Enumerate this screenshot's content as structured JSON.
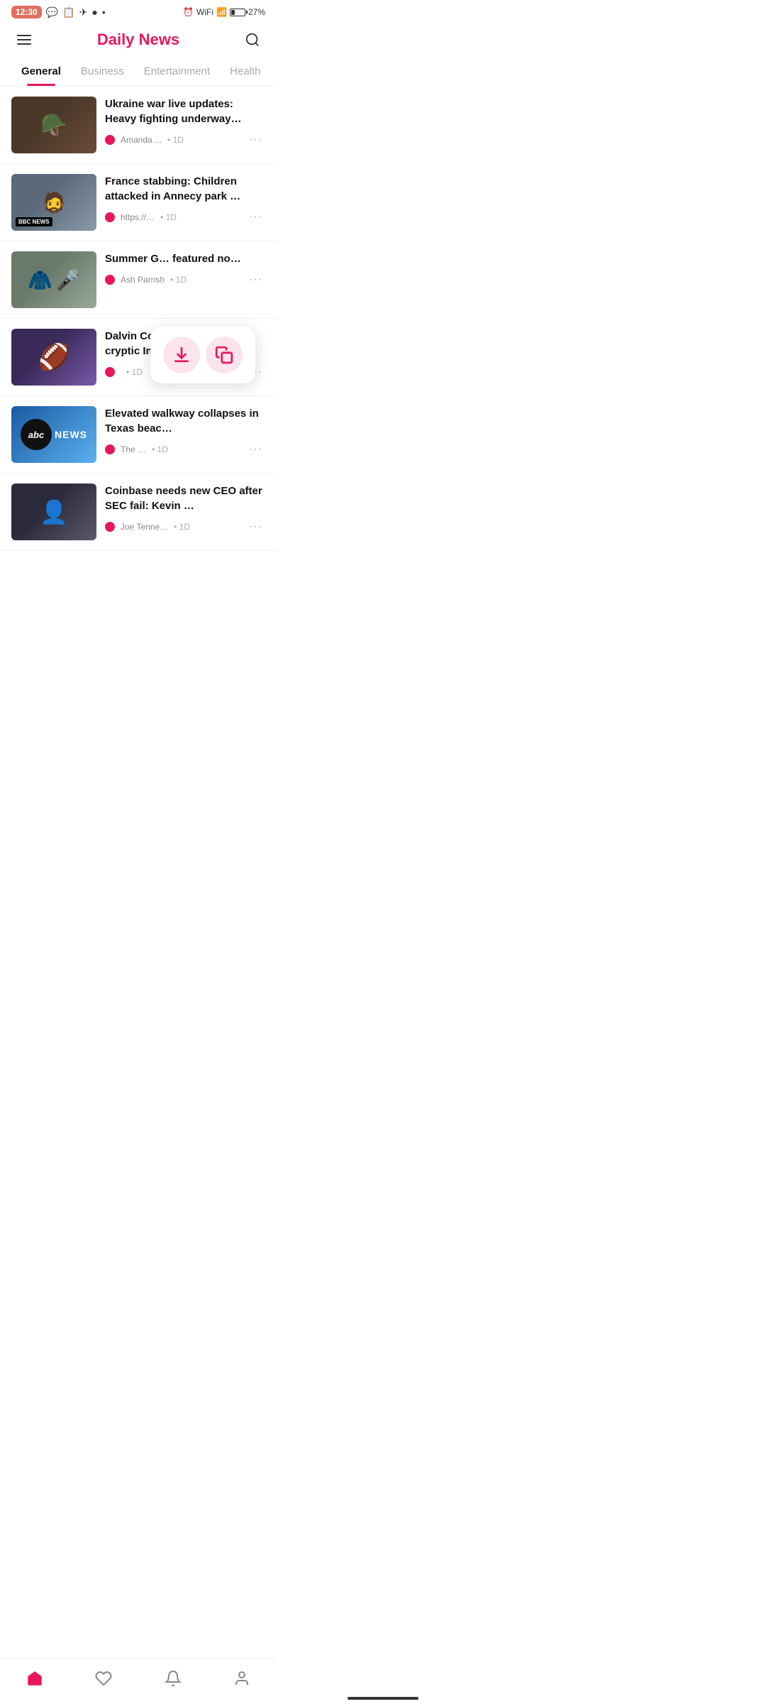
{
  "statusBar": {
    "time": "12:30",
    "battery": "27%"
  },
  "header": {
    "title": "Daily News",
    "menuLabel": "menu",
    "searchLabel": "search"
  },
  "tabs": [
    {
      "id": "general",
      "label": "General",
      "active": true
    },
    {
      "id": "business",
      "label": "Business",
      "active": false
    },
    {
      "id": "entertainment",
      "label": "Entertainment",
      "active": false
    },
    {
      "id": "health",
      "label": "Health",
      "active": false
    }
  ],
  "news": [
    {
      "id": 1,
      "title": "Ukraine war live updates: Heavy fighting underway…",
      "author": "Amanda ...",
      "timeAgo": "1D",
      "thumbClass": "thumb-1"
    },
    {
      "id": 2,
      "title": "France stabbing: Children attacked in Annecy park …",
      "author": "https://…",
      "timeAgo": "1D",
      "thumbClass": "thumb-2",
      "hasBBC": true
    },
    {
      "id": 3,
      "title": "Summer G… featured no…",
      "author": "Ash Parrish",
      "timeAgo": "1D",
      "thumbClass": "thumb-3"
    },
    {
      "id": 4,
      "title": "Dalvin Cook rumors: RB's cryptic Instagram post …",
      "author": "",
      "timeAgo": "1D",
      "thumbClass": "thumb-4"
    },
    {
      "id": 5,
      "title": "Elevated walkway collapses in Texas beac…",
      "author": "The …",
      "timeAgo": "1D",
      "thumbClass": "thumb-5",
      "isABC": true
    },
    {
      "id": 6,
      "title": "Coinbase needs new CEO after SEC fail: Kevin …",
      "author": "Joe Tenne…",
      "timeAgo": "1D",
      "thumbClass": "thumb-6"
    }
  ],
  "floatButtons": [
    {
      "id": "download",
      "label": "Download"
    },
    {
      "id": "copy",
      "label": "Copy"
    }
  ],
  "bottomNav": [
    {
      "id": "home",
      "label": "Home",
      "active": true
    },
    {
      "id": "favorites",
      "label": "Favorites",
      "active": false
    },
    {
      "id": "notifications",
      "label": "Notifications",
      "active": false
    },
    {
      "id": "profile",
      "label": "Profile",
      "active": false
    }
  ]
}
